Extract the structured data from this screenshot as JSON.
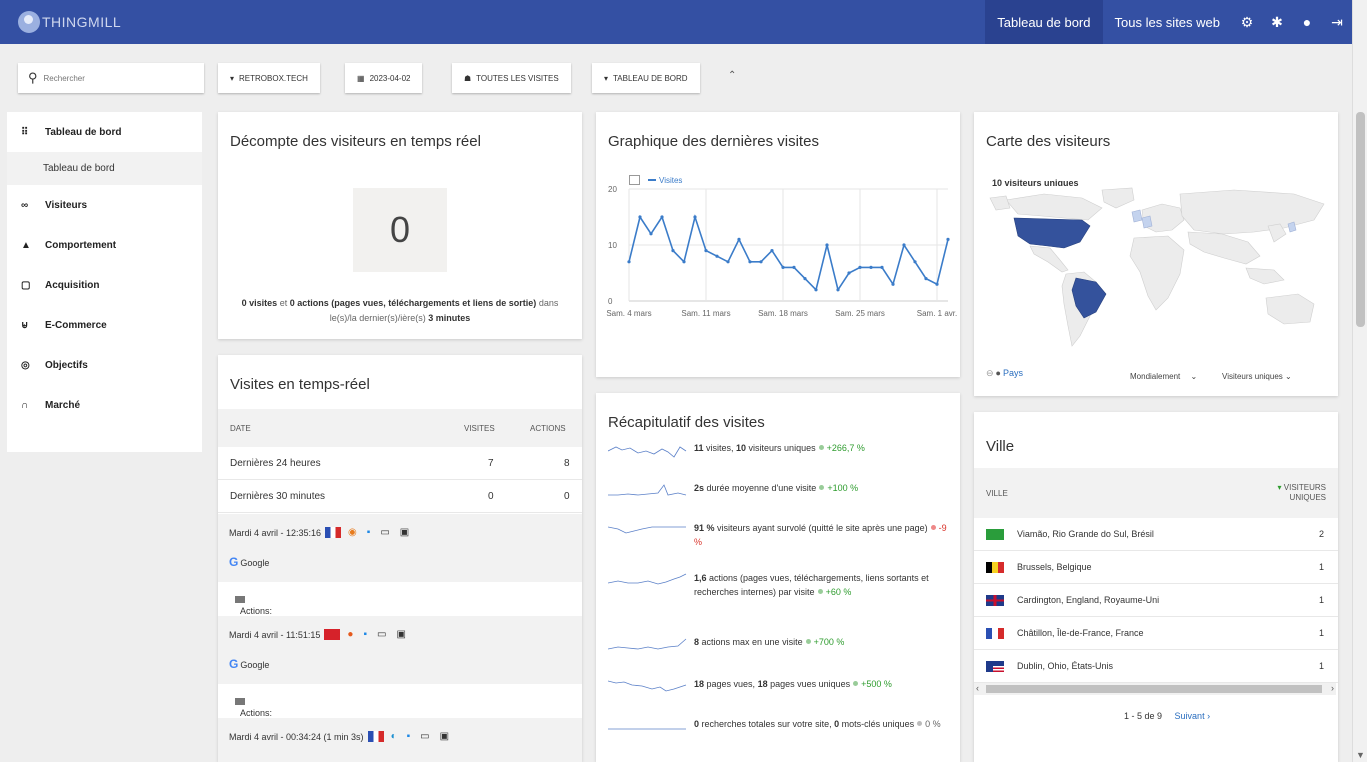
{
  "header": {
    "logo_text": "THINGMILL",
    "nav": [
      "Tableau de bord",
      "Tous les sites web"
    ],
    "icons": [
      "gear-icon",
      "bug-icon",
      "info-icon",
      "logout-icon"
    ]
  },
  "toolbar": {
    "search_placeholder": "Rechercher",
    "site": "RETROBOX.TECH",
    "date": "2023-04-02",
    "segment": "TOUTES LES VISITES",
    "dashboard": "TABLEAU DE BORD"
  },
  "sidebar": {
    "items": [
      {
        "label": "Tableau de bord",
        "icon": "grid-icon"
      },
      {
        "label": "Visiteurs",
        "icon": "binoculars-icon"
      },
      {
        "label": "Comportement",
        "icon": "bell-icon"
      },
      {
        "label": "Acquisition",
        "icon": "window-icon"
      },
      {
        "label": "E-Commerce",
        "icon": "cart-icon"
      },
      {
        "label": "Objectifs",
        "icon": "target-icon"
      },
      {
        "label": "Marché",
        "icon": "marketplace-icon"
      }
    ],
    "sub_item": "Tableau de bord"
  },
  "counter": {
    "title": "Décompte des visiteurs en temps réel",
    "value": "0",
    "visits": "0 visites",
    "and": "et",
    "actions": "0 actions (pages vues, téléchargements et liens de sortie)",
    "in_last": "dans le(s)/la dernier(s)/ière(s)",
    "minutes": "3 minutes"
  },
  "realtime": {
    "title": "Visites en temps-réel",
    "col_date": "DATE",
    "col_visits": "VISITES",
    "col_actions": "ACTIONS",
    "rows": [
      {
        "label": "Dernières 24 heures",
        "visits": "7",
        "actions": "8"
      },
      {
        "label": "Dernières 30 minutes",
        "visits": "0",
        "actions": "0"
      }
    ],
    "visits_list": [
      {
        "time": "Mardi 4 avril - 12:35:16",
        "referrer": "Google"
      },
      {
        "time": "Mardi 4 avril - 11:51:15",
        "referrer": "Google"
      },
      {
        "time": "Mardi 4 avril - 00:34:24 (1 min 3s)",
        "referrer": ""
      }
    ],
    "actions_label": "Actions:"
  },
  "graph": {
    "title": "Graphique des dernières visites",
    "legend": "Visites"
  },
  "chart_data": {
    "type": "line",
    "x": [
      "Sam. 4 mars",
      "5",
      "6",
      "7",
      "8",
      "9",
      "10",
      "Sam. 11 mars",
      "12",
      "13",
      "14",
      "15",
      "16",
      "17",
      "Sam. 18 mars",
      "19",
      "20",
      "21",
      "22",
      "23",
      "24",
      "Sam. 25 mars",
      "26",
      "27",
      "28",
      "29",
      "30",
      "31",
      "Sam. 1 avr.",
      "2"
    ],
    "tick_labels": [
      "Sam. 4 mars",
      "Sam. 11 mars",
      "Sam. 18 mars",
      "Sam. 25 mars",
      "Sam. 1 avr."
    ],
    "series": [
      {
        "name": "Visites",
        "values": [
          7,
          15,
          12,
          15,
          9,
          7,
          15,
          9,
          8,
          7,
          11,
          7,
          7,
          9,
          6,
          6,
          4,
          2,
          10,
          2,
          5,
          6,
          6,
          6,
          3,
          10,
          7,
          4,
          3,
          11
        ]
      }
    ],
    "ylim": [
      0,
      20
    ],
    "yticks": [
      0,
      10,
      20
    ],
    "color": "#3b7cc9"
  },
  "summary": {
    "title": "Récapitulatif des visites",
    "rows": [
      {
        "p1": "11",
        "t1": " visites, ",
        "p2": "10",
        "t2": " visiteurs uniques",
        "trend": "+266,7 %",
        "dir": "up"
      },
      {
        "p1": "2s",
        "t1": " durée moyenne d'une visite",
        "p2": "",
        "t2": "",
        "trend": "+100 %",
        "dir": "up"
      },
      {
        "p1": "91 %",
        "t1": " visiteurs ayant survolé (quitté le site après une page)",
        "p2": "",
        "t2": "",
        "trend": "-9 %",
        "dir": "down"
      },
      {
        "p1": "1,6",
        "t1": " actions (pages vues, téléchargements, liens sortants et recherches internes) par visite",
        "p2": "",
        "t2": "",
        "trend": "+60 %",
        "dir": "up"
      },
      {
        "p1": "8",
        "t1": " actions max en une visite",
        "p2": "",
        "t2": "",
        "trend": "+700 %",
        "dir": "up"
      },
      {
        "p1": "18",
        "t1": " pages vues, ",
        "p2": "18",
        "t2": " pages vues uniques",
        "trend": "+500 %",
        "dir": "up"
      },
      {
        "p1": "0",
        "t1": " recherches totales sur votre site, ",
        "p2": "0",
        "t2": " mots-clés uniques",
        "trend": "0 %",
        "dir": "flat"
      }
    ]
  },
  "map": {
    "title": "Carte des visiteurs",
    "note": "10 visiteurs uniques",
    "pays": "Pays",
    "scope": "Mondialement",
    "metric": "Visiteurs uniques"
  },
  "ville": {
    "title": "Ville",
    "col_city": "VILLE",
    "col_metric": "VISITEURS UNIQUES",
    "rows": [
      {
        "city": "Viamão, Rio Grande do Sul, Brésil",
        "value": "2"
      },
      {
        "city": "Brussels, Belgique",
        "value": "1"
      },
      {
        "city": "Cardington, England, Royaume-Uni",
        "value": "1"
      },
      {
        "city": "Châtillon, Île-de-France, France",
        "value": "1"
      },
      {
        "city": "Dublin, Ohio, États-Unis",
        "value": "1"
      }
    ],
    "pager": "1 - 5 de 9",
    "next": "Suivant ›"
  }
}
